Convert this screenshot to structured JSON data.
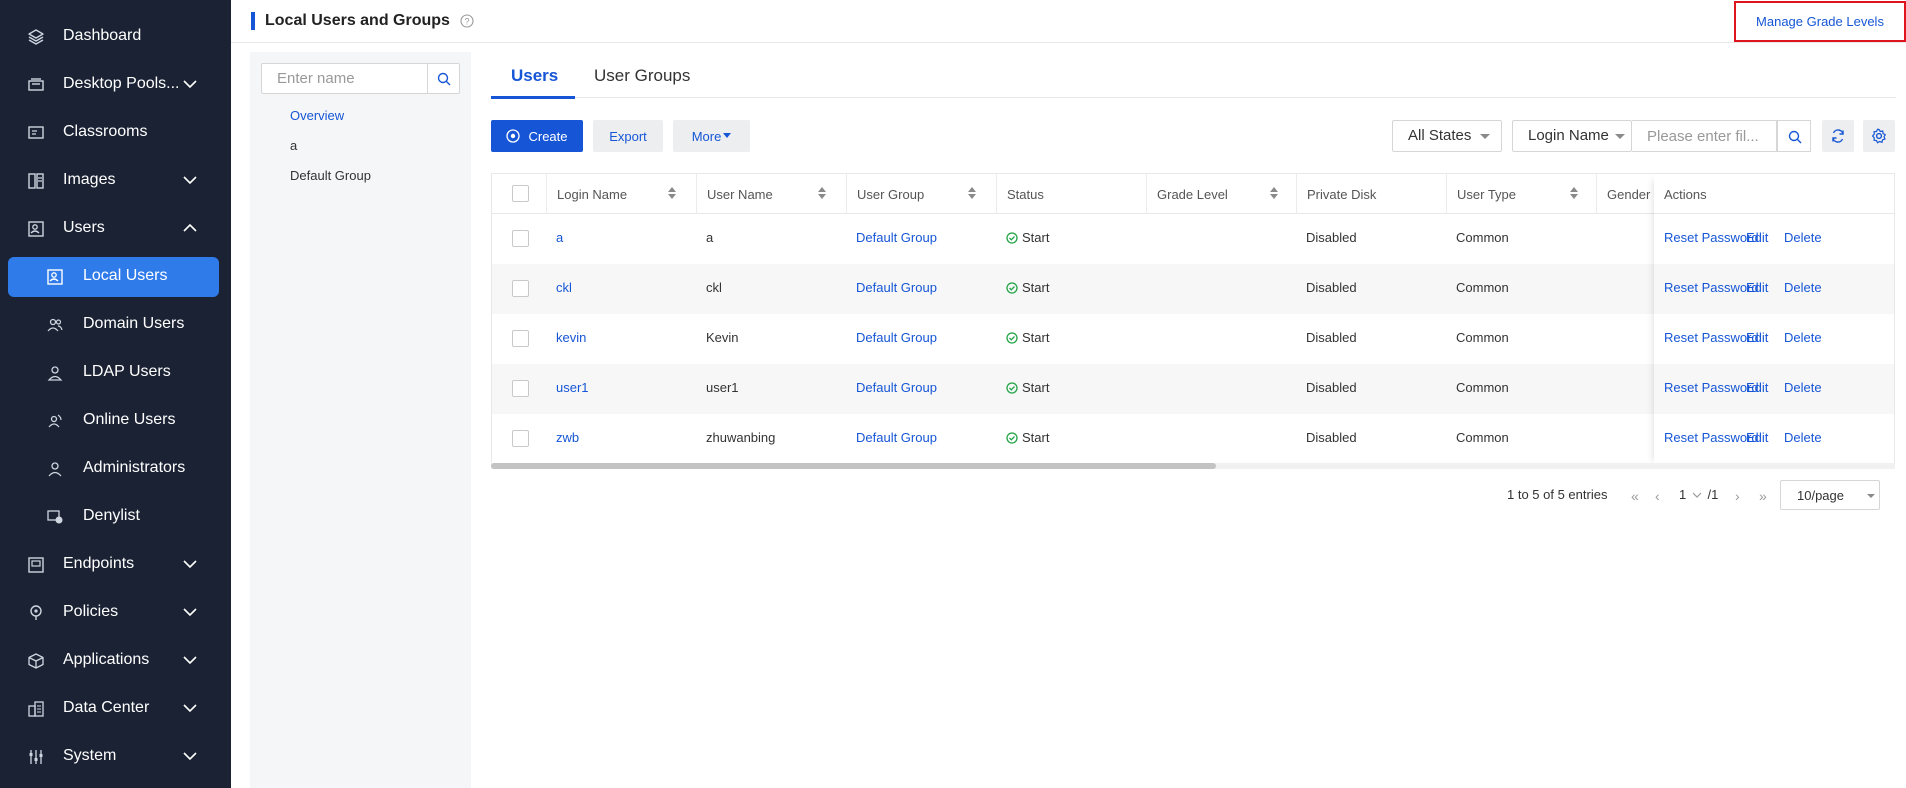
{
  "sidebar": {
    "items": [
      {
        "label": "Dashboard",
        "icon": "layers-icon"
      },
      {
        "label": "Desktop Pools...",
        "icon": "desktop-icon"
      },
      {
        "label": "Classrooms",
        "icon": "classroom-icon"
      },
      {
        "label": "Images",
        "icon": "image-icon"
      },
      {
        "label": "Users",
        "icon": "users-icon"
      },
      {
        "label": "Local Users",
        "icon": "local-user-icon"
      },
      {
        "label": "Domain Users",
        "icon": "domain-users-icon"
      },
      {
        "label": "LDAP Users",
        "icon": "ldap-user-icon"
      },
      {
        "label": "Online Users",
        "icon": "online-user-icon"
      },
      {
        "label": "Administrators",
        "icon": "admin-icon"
      },
      {
        "label": "Denylist",
        "icon": "denylist-icon"
      },
      {
        "label": "Endpoints",
        "icon": "endpoint-icon"
      },
      {
        "label": "Policies",
        "icon": "policy-icon"
      },
      {
        "label": "Applications",
        "icon": "applications-icon"
      },
      {
        "label": "Data Center",
        "icon": "datacenter-icon"
      },
      {
        "label": "System",
        "icon": "system-icon"
      }
    ],
    "bg_color": "#1a2233",
    "active_color": "#2f7bea"
  },
  "header": {
    "title": "Local Users and Groups",
    "manage_label": "Manage Grade Levels"
  },
  "tree": {
    "search_placeholder": "Enter name",
    "items": [
      "Overview",
      "a",
      "Default Group"
    ]
  },
  "tabs": [
    "Users",
    "User Groups"
  ],
  "toolbar": {
    "create_label": "Create",
    "export_label": "Export",
    "more_label": "More",
    "state_filter": "All States",
    "field_filter": "Login Name",
    "filter_placeholder": "Please enter fil..."
  },
  "table": {
    "columns": [
      "Login Name",
      "User Name",
      "User Group",
      "Status",
      "Grade Level",
      "Private Disk",
      "User Type",
      "Gender",
      "Actions"
    ],
    "rows": [
      {
        "login": "a",
        "name": "a",
        "group": "Default Group",
        "status": "Start",
        "grade": "",
        "disk": "Disabled",
        "type": "Common",
        "gender": ""
      },
      {
        "login": "ckl",
        "name": "ckl",
        "group": "Default Group",
        "status": "Start",
        "grade": "",
        "disk": "Disabled",
        "type": "Common",
        "gender": ""
      },
      {
        "login": "kevin",
        "name": "Kevin",
        "group": "Default Group",
        "status": "Start",
        "grade": "",
        "disk": "Disabled",
        "type": "Common",
        "gender": ""
      },
      {
        "login": "user1",
        "name": "user1",
        "group": "Default Group",
        "status": "Start",
        "grade": "",
        "disk": "Disabled",
        "type": "Common",
        "gender": ""
      },
      {
        "login": "zwb",
        "name": "zhuwanbing",
        "group": "Default Group",
        "status": "Start",
        "grade": "",
        "disk": "Disabled",
        "type": "Common",
        "gender": ""
      }
    ],
    "actions": [
      "Reset Password",
      "Edit",
      "Delete"
    ]
  },
  "pagination": {
    "summary": "1 to 5 of 5 entries",
    "page": "1",
    "total": "/1",
    "page_size": "10/page"
  },
  "colors": {
    "primary": "#1656d6",
    "success": "#22a447",
    "highlight": "#e0141e"
  }
}
